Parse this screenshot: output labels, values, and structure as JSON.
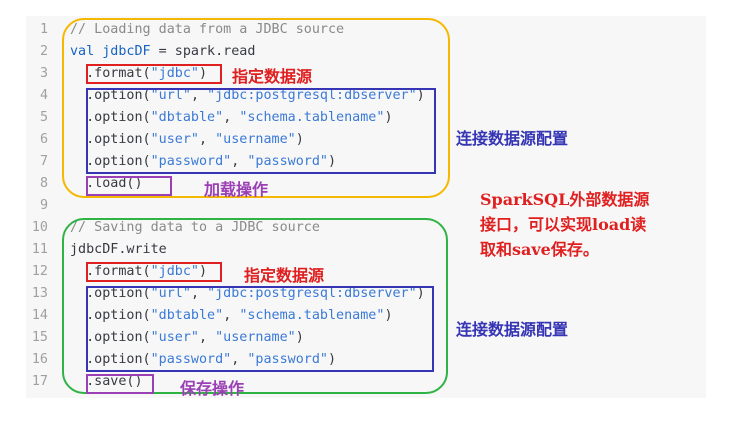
{
  "code_lines": [
    {
      "num": "1",
      "parts": [
        {
          "t": "// Loading data from a JDBC source",
          "c": "cm"
        }
      ]
    },
    {
      "num": "2",
      "parts": [
        {
          "t": "val ",
          "c": "kw"
        },
        {
          "t": "jdbcDF",
          "c": "kw"
        },
        {
          "t": " = spark.read",
          "c": ""
        }
      ]
    },
    {
      "num": "3",
      "parts": [
        {
          "t": "  .format(",
          "c": ""
        },
        {
          "t": "\"jdbc\"",
          "c": "str"
        },
        {
          "t": ")",
          "c": ""
        }
      ]
    },
    {
      "num": "4",
      "parts": [
        {
          "t": "  .option(",
          "c": ""
        },
        {
          "t": "\"url\"",
          "c": "str"
        },
        {
          "t": ", ",
          "c": ""
        },
        {
          "t": "\"jdbc:postgresql:dbserver\"",
          "c": "str"
        },
        {
          "t": ")",
          "c": ""
        }
      ]
    },
    {
      "num": "5",
      "parts": [
        {
          "t": "  .option(",
          "c": ""
        },
        {
          "t": "\"dbtable\"",
          "c": "str"
        },
        {
          "t": ", ",
          "c": ""
        },
        {
          "t": "\"schema.tablename\"",
          "c": "str"
        },
        {
          "t": ")",
          "c": ""
        }
      ]
    },
    {
      "num": "6",
      "parts": [
        {
          "t": "  .option(",
          "c": ""
        },
        {
          "t": "\"user\"",
          "c": "str"
        },
        {
          "t": ", ",
          "c": ""
        },
        {
          "t": "\"username\"",
          "c": "str"
        },
        {
          "t": ")",
          "c": ""
        }
      ]
    },
    {
      "num": "7",
      "parts": [
        {
          "t": "  .option(",
          "c": ""
        },
        {
          "t": "\"password\"",
          "c": "str"
        },
        {
          "t": ", ",
          "c": ""
        },
        {
          "t": "\"password\"",
          "c": "str"
        },
        {
          "t": ")",
          "c": ""
        }
      ]
    },
    {
      "num": "8",
      "parts": [
        {
          "t": "  .load()",
          "c": ""
        }
      ]
    },
    {
      "num": "9",
      "parts": []
    },
    {
      "num": "10",
      "parts": [
        {
          "t": "// Saving data to a JDBC source",
          "c": "cm"
        }
      ]
    },
    {
      "num": "11",
      "parts": [
        {
          "t": "jdbcDF.write",
          "c": ""
        }
      ]
    },
    {
      "num": "12",
      "parts": [
        {
          "t": "  .format(",
          "c": ""
        },
        {
          "t": "\"jdbc\"",
          "c": "str"
        },
        {
          "t": ")",
          "c": ""
        }
      ]
    },
    {
      "num": "13",
      "parts": [
        {
          "t": "  .option(",
          "c": ""
        },
        {
          "t": "\"url\"",
          "c": "str"
        },
        {
          "t": ", ",
          "c": ""
        },
        {
          "t": "\"jdbc:postgresql:dbserver\"",
          "c": "str"
        },
        {
          "t": ")",
          "c": ""
        }
      ]
    },
    {
      "num": "14",
      "parts": [
        {
          "t": "  .option(",
          "c": ""
        },
        {
          "t": "\"dbtable\"",
          "c": "str"
        },
        {
          "t": ", ",
          "c": ""
        },
        {
          "t": "\"schema.tablename\"",
          "c": "str"
        },
        {
          "t": ")",
          "c": ""
        }
      ]
    },
    {
      "num": "15",
      "parts": [
        {
          "t": "  .option(",
          "c": ""
        },
        {
          "t": "\"user\"",
          "c": "str"
        },
        {
          "t": ", ",
          "c": ""
        },
        {
          "t": "\"username\"",
          "c": "str"
        },
        {
          "t": ")",
          "c": ""
        }
      ]
    },
    {
      "num": "16",
      "parts": [
        {
          "t": "  .option(",
          "c": ""
        },
        {
          "t": "\"password\"",
          "c": "str"
        },
        {
          "t": ", ",
          "c": ""
        },
        {
          "t": "\"password\"",
          "c": "str"
        },
        {
          "t": ")",
          "c": ""
        }
      ]
    },
    {
      "num": "17",
      "parts": [
        {
          "t": "  .save()",
          "c": ""
        }
      ]
    }
  ],
  "annotations": {
    "read_format": "指定数据源",
    "read_options": "连接数据源配置",
    "read_load": "加载操作",
    "summary_line1": "SparkSQL外部数据源",
    "summary_line2": "接口，可以实现load读",
    "summary_line3": "取和save保存。",
    "write_format": "指定数据源",
    "write_options": "连接数据源配置",
    "write_save": "保存操作"
  },
  "colors": {
    "read_block_border": "#f5b800",
    "write_block_border": "#2fb344",
    "format_box": "#e02020",
    "options_box": "#3535b5",
    "action_box": "#9b3fb5",
    "annotation_red": "#e02020",
    "annotation_blue": "#3535b5",
    "annotation_purple": "#9b3fb5"
  }
}
